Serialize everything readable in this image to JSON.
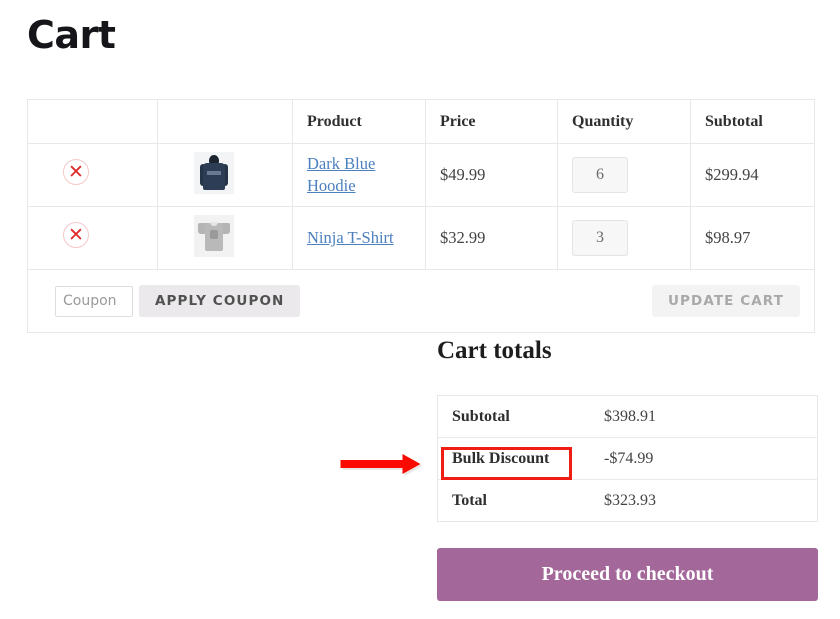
{
  "page": {
    "title": "Cart"
  },
  "cart_table": {
    "headers": [
      "",
      "",
      "Product",
      "Price",
      "Quantity",
      "Subtotal"
    ],
    "rows": [
      {
        "remove_icon": "remove-x-icon",
        "thumb_icon": "hoodie-thumbnail",
        "product": "Dark Blue Hoodie",
        "price": "$49.99",
        "quantity": "6",
        "subtotal": "$299.94"
      },
      {
        "remove_icon": "remove-x-icon",
        "thumb_icon": "tshirt-thumbnail",
        "product": "Ninja T-Shirt",
        "price": "$32.99",
        "quantity": "3",
        "subtotal": "$98.97"
      }
    ],
    "actions": {
      "coupon_placeholder": "Coupon",
      "coupon_value": "",
      "apply_coupon_label": "APPLY COUPON",
      "update_cart_label": "UPDATE CART"
    }
  },
  "cart_totals": {
    "title": "Cart totals",
    "rows": [
      {
        "label": "Subtotal",
        "value": "$398.91"
      },
      {
        "label": "Bulk Discount",
        "value": "-$74.99"
      },
      {
        "label": "Total",
        "value": "$323.93"
      }
    ],
    "checkout_label": "Proceed to checkout"
  },
  "annotation": {
    "highlight_target": "Bulk Discount",
    "box_color": "#f01d12",
    "arrow_color": "#fa0a00"
  },
  "colors": {
    "link": "#4b7fbe",
    "remove": "#e02b2b",
    "checkout_button": "#a3679a",
    "apply_button": "#ebe9eb",
    "update_button_text": "#a9a9a9",
    "border": "#e8e8e8"
  }
}
